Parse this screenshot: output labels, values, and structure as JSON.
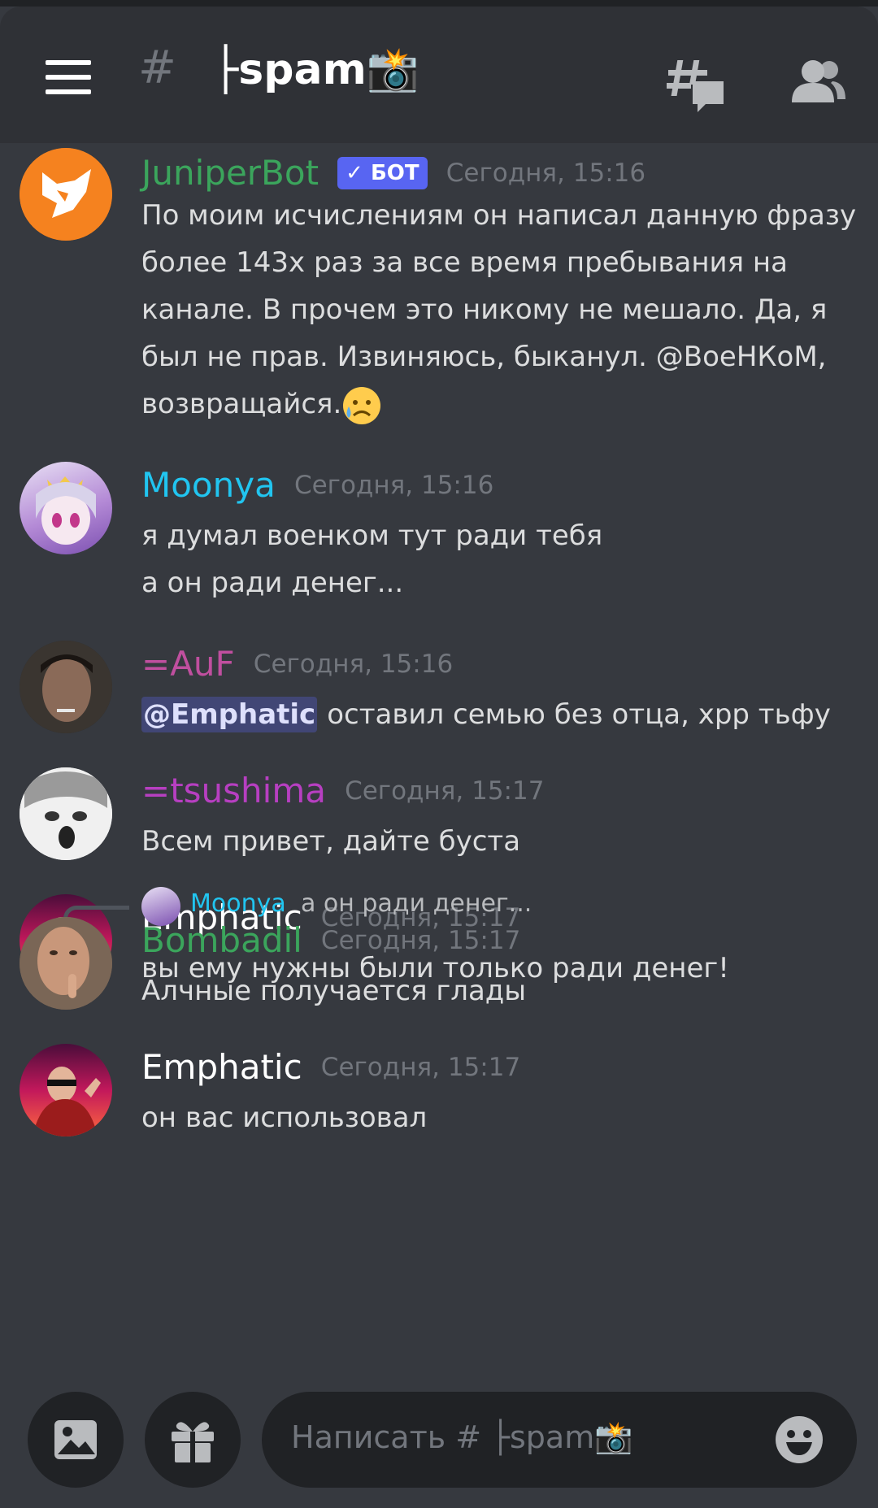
{
  "header": {
    "channel_prefix": "#",
    "channel_name": "├spam📸",
    "icons": [
      "menu-icon",
      "channel-hash-icon",
      "threads-icon",
      "members-icon"
    ]
  },
  "messages": [
    {
      "author": "JuniperBot",
      "author_color": "#3ba55c",
      "badge": "✓ БОТ",
      "timestamp": "Сегодня, 15:16",
      "lines": [
        "По моим исчислениям он написал данную фразу более 143х раз за все время пребывания на канале. В прочем это никому не мешало. Да, я был не прав. Извиняюсь, быканул. @ВоеНКоМ, возвращайся."
      ],
      "emoji": "😥"
    },
    {
      "author": "Moonya",
      "author_color": "#21c5f0",
      "timestamp": "Сегодня, 15:16",
      "lines": [
        "я думал военком тут ради тебя",
        "а он ради денег..."
      ]
    },
    {
      "author": "=AuF",
      "author_color": "#c04f9f",
      "timestamp": "Сегодня, 15:16",
      "mention": "@Emphatic",
      "lines": [
        "оставил семью без отца, хрр тьфу"
      ]
    },
    {
      "author": "=tsushima",
      "author_color": "#b73fc1",
      "timestamp": "Сегодня, 15:17",
      "lines": [
        "Всем привет, дайте буста"
      ]
    },
    {
      "author": "Emphatic",
      "author_color": "#ffffff",
      "timestamp": "Сегодня, 15:17",
      "lines": [
        "вы ему нужны были только ради денег!"
      ]
    },
    {
      "reply_to": {
        "author": "Moonya",
        "text": "а он ради денег..."
      },
      "author": "Bombadil",
      "author_color": "#3ba55c",
      "timestamp": "Сегодня, 15:17",
      "lines": [
        "Алчные получается глады"
      ]
    },
    {
      "author": "Emphatic",
      "author_color": "#ffffff",
      "timestamp": "Сегодня, 15:17",
      "lines": [
        "он вас использовал"
      ]
    }
  ],
  "composer": {
    "placeholder": "Написать # ├spam📸",
    "buttons": [
      "image-icon",
      "gift-icon",
      "emoji-icon"
    ]
  }
}
